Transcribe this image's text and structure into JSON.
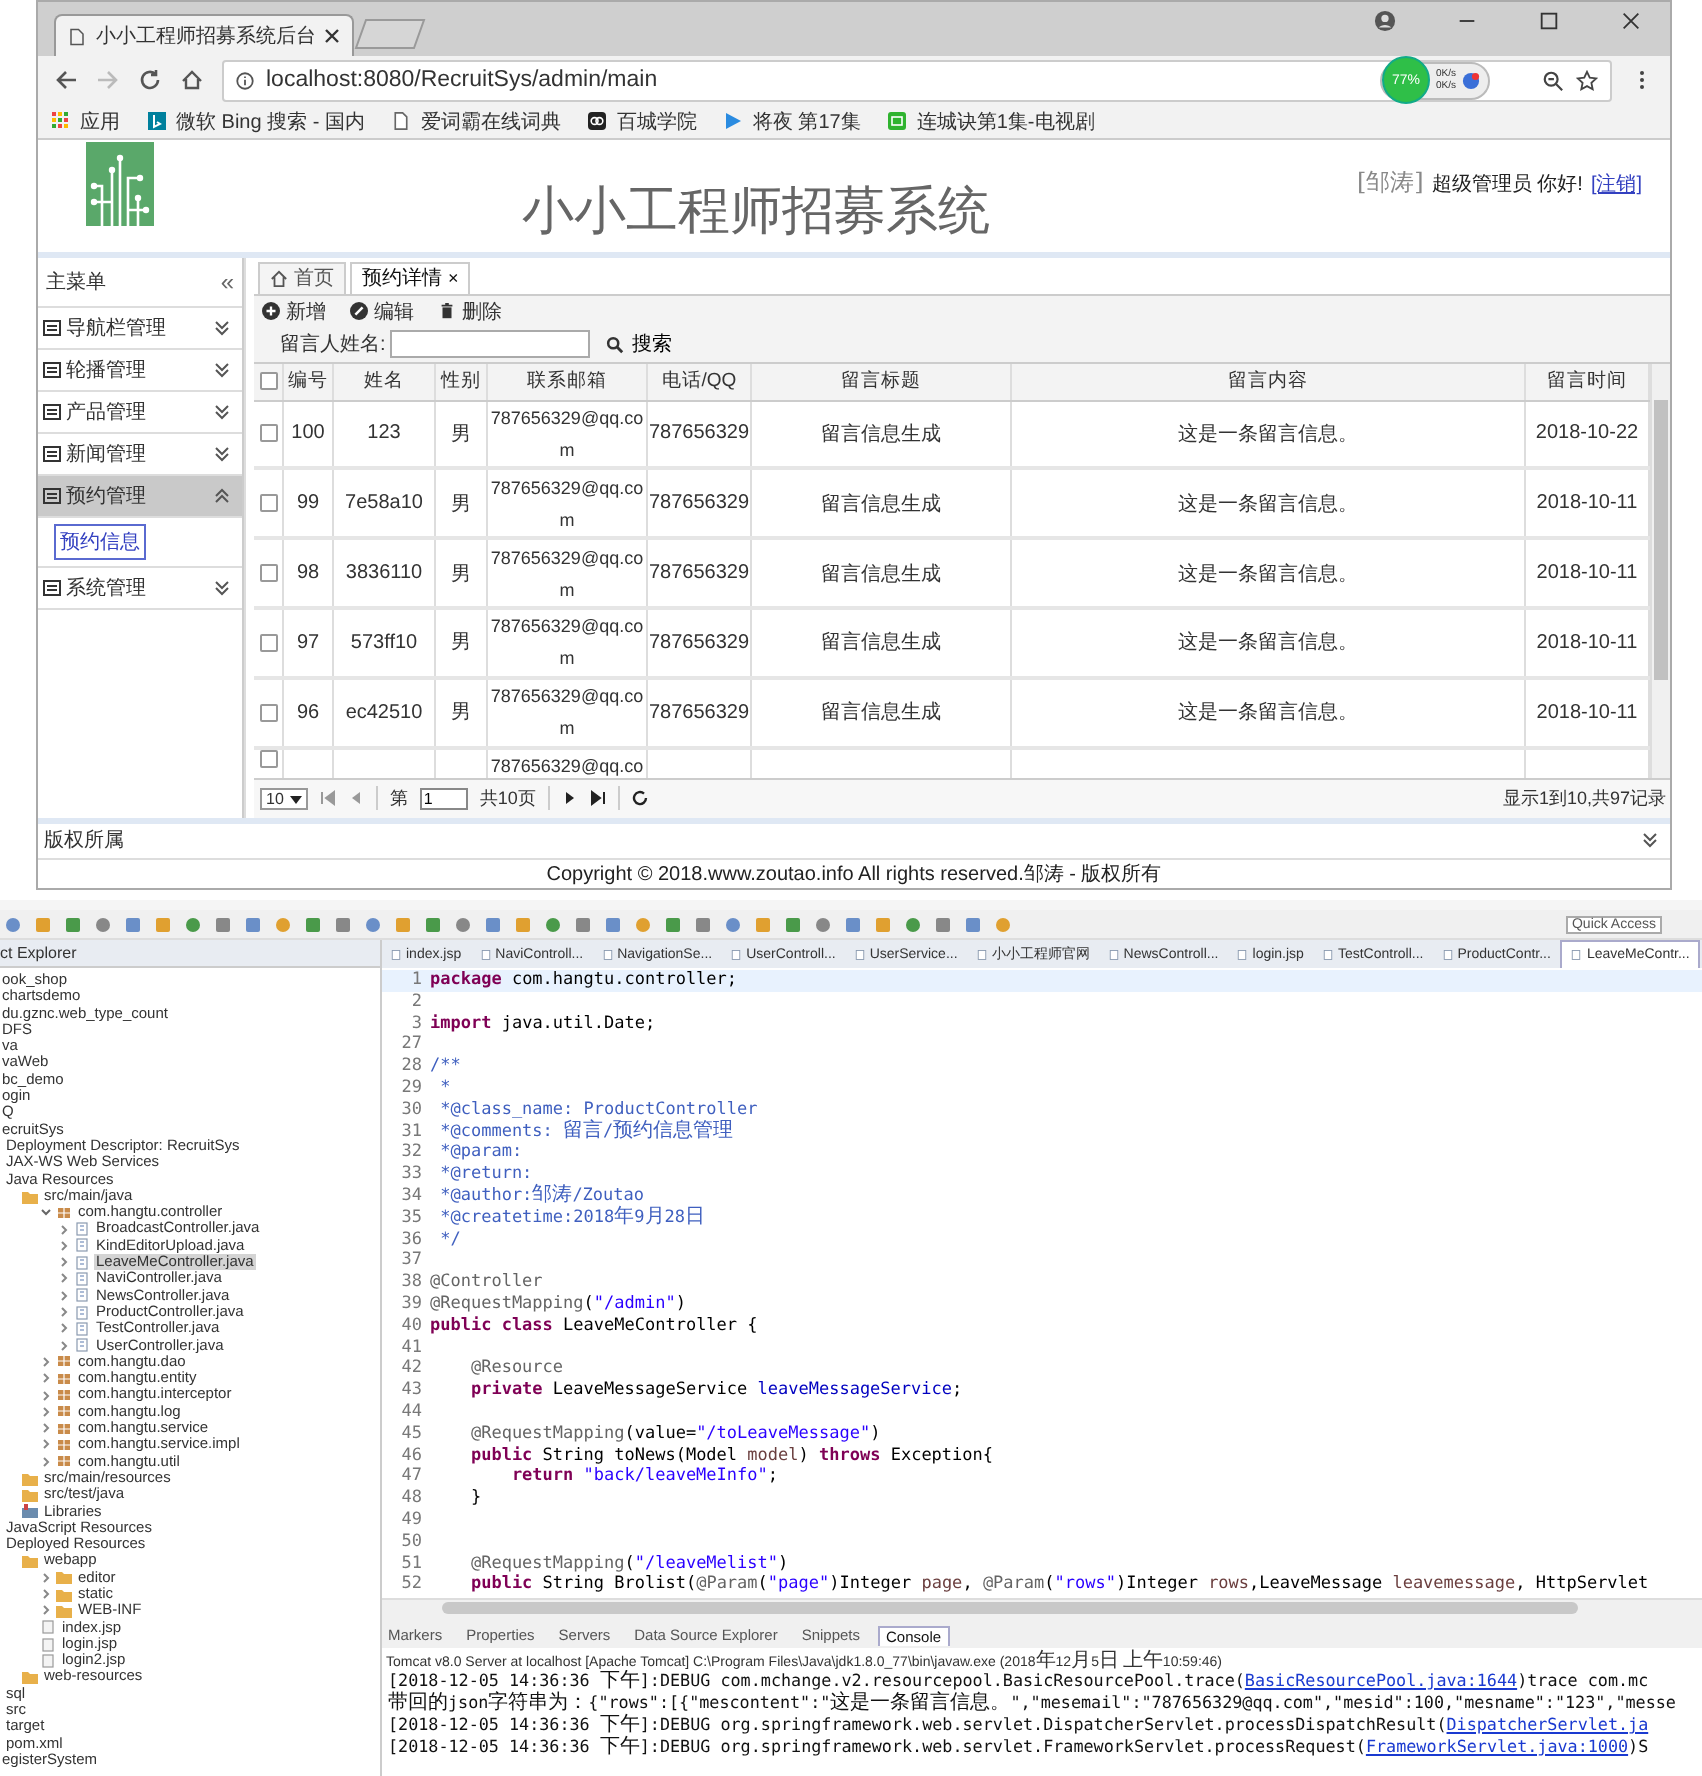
{
  "browser": {
    "tab": {
      "title": "小小工程师招募系统后台",
      "selected": true
    },
    "address": "localhost:8080/RecruitSys/admin/main",
    "extension": {
      "percent": "77%",
      "up": "0K/s",
      "down": "0K/s"
    },
    "bookmarks": [
      {
        "label": "应用",
        "kind": "apps"
      },
      {
        "label": "微软 Bing 搜索 - 国内",
        "kind": "bing"
      },
      {
        "label": "爱词霸在线词典",
        "kind": "page"
      },
      {
        "label": "百城学院",
        "kind": "dark"
      },
      {
        "label": "将夜 第17集",
        "kind": "play"
      },
      {
        "label": "连城诀第1集-电视剧",
        "kind": "green"
      }
    ]
  },
  "page": {
    "title": "小小工程师招募系统",
    "user": "[邹涛]",
    "greeting": "超级管理员 你好!",
    "logout": "[注销]",
    "menu_title": "主菜单",
    "collapse_mark": "«",
    "menu": [
      {
        "label": "导航栏管理",
        "expanded": false,
        "selected": false
      },
      {
        "label": "轮播管理",
        "expanded": false,
        "selected": false
      },
      {
        "label": "产品管理",
        "expanded": false,
        "selected": false
      },
      {
        "label": "新闻管理",
        "expanded": false,
        "selected": false
      },
      {
        "label": "预约管理",
        "expanded": true,
        "selected": true,
        "children": [
          {
            "label": "预约信息",
            "selected": true
          }
        ]
      },
      {
        "label": "系统管理",
        "expanded": false,
        "selected": false
      }
    ],
    "tabs": [
      {
        "label": "首页",
        "selected": false,
        "closable": false
      },
      {
        "label": "预约详情",
        "selected": true,
        "closable": true
      }
    ],
    "close_mark": "×",
    "toolbar": [
      "新增",
      "编辑",
      "删除"
    ],
    "search": {
      "label": "留言人姓名:",
      "button": "搜索"
    },
    "table": {
      "all_checked": false,
      "columns": [
        "编号",
        "姓名",
        "性别",
        "联系邮箱",
        "电话/QQ",
        "留言标题",
        "留言内容",
        "留言时间"
      ],
      "rows": [
        {
          "checked": false,
          "cells": [
            "100",
            "123",
            "男",
            "787656329@qq.com",
            "787656329",
            "留言信息生成",
            "这是一条留言信息。",
            "2018-10-22"
          ]
        },
        {
          "checked": false,
          "cells": [
            "99",
            "7e58a10",
            "男",
            "787656329@qq.com",
            "787656329",
            "留言信息生成",
            "这是一条留言信息。",
            "2018-10-11"
          ]
        },
        {
          "checked": false,
          "cells": [
            "98",
            "3836110",
            "男",
            "787656329@qq.com",
            "787656329",
            "留言信息生成",
            "这是一条留言信息。",
            "2018-10-11"
          ]
        },
        {
          "checked": false,
          "cells": [
            "97",
            "573ff10",
            "男",
            "787656329@qq.com",
            "787656329",
            "留言信息生成",
            "这是一条留言信息。",
            "2018-10-11"
          ]
        },
        {
          "checked": false,
          "cells": [
            "96",
            "ec42510",
            "男",
            "787656329@qq.com",
            "787656329",
            "留言信息生成",
            "这是一条留言信息。",
            "2018-10-11"
          ]
        },
        {
          "checked": false,
          "cells": [
            null,
            null,
            null,
            "787656329@qq.co",
            null,
            null,
            null,
            null
          ]
        }
      ]
    },
    "pager": {
      "size": "10",
      "page_label": "第",
      "page": "1",
      "total": "共10页",
      "summary": "显示1到10,共97记录"
    },
    "footer_title": "版权所属",
    "copyright": "Copyright © 2018.www.zoutao.info All rights reserved.邹涛 - 版权所有"
  },
  "ide": {
    "explorer_title": "ct Explorer",
    "tree": [
      {
        "label": "ook_shop",
        "selected": false
      },
      {
        "label": "chartsdemo",
        "selected": false
      },
      {
        "label": "du.gznc.web_type_count",
        "selected": false
      },
      {
        "label": "DFS",
        "selected": false
      },
      {
        "label": "va",
        "selected": false
      },
      {
        "label": "vaWeb",
        "selected": false
      },
      {
        "label": "bc_demo",
        "selected": false
      },
      {
        "label": "ogin",
        "selected": false
      },
      {
        "label": "Q",
        "selected": false
      },
      {
        "label": "ecruitSys",
        "selected": false,
        "children": [
          {
            "label": "Deployment Descriptor: RecruitSys",
            "selected": false
          },
          {
            "label": "JAX-WS Web Services",
            "selected": false
          },
          {
            "label": "Java Resources",
            "selected": false,
            "children": [
              {
                "label": "src/main/java",
                "kind": "folder",
                "selected": false,
                "children": [
                  {
                    "label": "com.hangtu.controller",
                    "kind": "package",
                    "expanded": true,
                    "selected": false,
                    "children": [
                      {
                        "label": "BroadcastController.java",
                        "kind": "java",
                        "expanded": false,
                        "selected": false
                      },
                      {
                        "label": "KindEditorUpload.java",
                        "kind": "java",
                        "expanded": false,
                        "selected": false
                      },
                      {
                        "label": "LeaveMeController.java",
                        "kind": "java",
                        "expanded": false,
                        "selected": true
                      },
                      {
                        "label": "NaviController.java",
                        "kind": "java",
                        "expanded": false,
                        "selected": false
                      },
                      {
                        "label": "NewsController.java",
                        "kind": "java",
                        "expanded": false,
                        "selected": false
                      },
                      {
                        "label": "ProductController.java",
                        "kind": "java",
                        "expanded": false,
                        "selected": false
                      },
                      {
                        "label": "TestController.java",
                        "kind": "java",
                        "expanded": false,
                        "selected": false
                      },
                      {
                        "label": "UserController.java",
                        "kind": "java",
                        "expanded": false,
                        "selected": false
                      }
                    ]
                  },
                  {
                    "label": "com.hangtu.dao",
                    "kind": "package",
                    "expanded": false,
                    "selected": false
                  },
                  {
                    "label": "com.hangtu.entity",
                    "kind": "package",
                    "expanded": false,
                    "selected": false
                  },
                  {
                    "label": "com.hangtu.interceptor",
                    "kind": "package",
                    "expanded": false,
                    "selected": false
                  },
                  {
                    "label": "com.hangtu.log",
                    "kind": "package",
                    "expanded": false,
                    "selected": false
                  },
                  {
                    "label": "com.hangtu.service",
                    "kind": "package",
                    "expanded": false,
                    "selected": false
                  },
                  {
                    "label": "com.hangtu.service.impl",
                    "kind": "package",
                    "expanded": false,
                    "selected": false
                  },
                  {
                    "label": "com.hangtu.util",
                    "kind": "package",
                    "expanded": false,
                    "selected": false
                  }
                ]
              },
              {
                "label": "src/main/resources",
                "kind": "folder",
                "selected": false
              },
              {
                "label": "src/test/java",
                "kind": "folder",
                "selected": false
              },
              {
                "label": "Libraries",
                "kind": "library",
                "selected": false
              }
            ]
          },
          {
            "label": "JavaScript Resources",
            "selected": false
          },
          {
            "label": "Deployed Resources",
            "selected": false,
            "children": [
              {
                "label": "webapp",
                "kind": "folder",
                "selected": false,
                "children": [
                  {
                    "label": "editor",
                    "kind": "folder",
                    "expanded": false,
                    "selected": false
                  },
                  {
                    "label": "static",
                    "kind": "folder",
                    "expanded": false,
                    "selected": false
                  },
                  {
                    "label": "WEB-INF",
                    "kind": "folder",
                    "expanded": false,
                    "selected": false
                  },
                  {
                    "label": "index.jsp",
                    "kind": "file",
                    "selected": false
                  },
                  {
                    "label": "login.jsp",
                    "kind": "file",
                    "selected": false
                  },
                  {
                    "label": "login2.jsp",
                    "kind": "file",
                    "selected": false
                  }
                ]
              },
              {
                "label": "web-resources",
                "kind": "folder",
                "selected": false
              }
            ]
          },
          {
            "label": "sql",
            "selected": false
          },
          {
            "label": "src",
            "selected": false
          },
          {
            "label": "target",
            "selected": false
          },
          {
            "label": "pom.xml",
            "selected": false
          }
        ]
      },
      {
        "label": "egisterSystem",
        "selected": false
      }
    ],
    "quick_access": "Quick Access",
    "editor_tabs": [
      {
        "label": "index.jsp",
        "selected": false
      },
      {
        "label": "NaviControll...",
        "selected": false
      },
      {
        "label": "NavigationSe...",
        "selected": false
      },
      {
        "label": "UserControll...",
        "selected": false
      },
      {
        "label": "UserService...",
        "selected": false
      },
      {
        "label": "小小工程师官网",
        "selected": false
      },
      {
        "label": "NewsControll...",
        "selected": false
      },
      {
        "label": "login.jsp",
        "selected": false
      },
      {
        "label": "TestControll...",
        "selected": false
      },
      {
        "label": "ProductContr...",
        "selected": false
      },
      {
        "label": "LeaveMeContr...",
        "selected": true
      }
    ],
    "code": [
      {
        "n": "1",
        "segments": [
          {
            "kind": "keyword",
            "text": "package"
          },
          {
            "kind": "plain",
            "text": " com.hangtu.controller;"
          }
        ]
      },
      {
        "n": "2"
      },
      {
        "n": "3",
        "segments": [
          {
            "kind": "keyword",
            "text": "import"
          },
          {
            "kind": "plain",
            "text": " java.util.Date;"
          }
        ]
      },
      {
        "n": "27"
      },
      {
        "n": "28",
        "segments": [
          {
            "kind": "doc",
            "text": "/**"
          }
        ]
      },
      {
        "n": "29",
        "segments": [
          {
            "kind": "doc",
            "text": " *"
          }
        ]
      },
      {
        "n": "30",
        "segments": [
          {
            "kind": "doc",
            "text": " *@class_name: ProductController"
          }
        ]
      },
      {
        "n": "31",
        "segments": [
          {
            "kind": "doc",
            "text": " *@comments: 留言/预约信息管理"
          }
        ]
      },
      {
        "n": "32",
        "segments": [
          {
            "kind": "doc",
            "text": " *@param:"
          }
        ]
      },
      {
        "n": "33",
        "segments": [
          {
            "kind": "doc",
            "text": " *@return:"
          }
        ]
      },
      {
        "n": "34",
        "segments": [
          {
            "kind": "doc",
            "text": " *@author:邹涛/Zoutao"
          }
        ]
      },
      {
        "n": "35",
        "segments": [
          {
            "kind": "doc",
            "text": " *@createtime:2018年9月28日"
          }
        ]
      },
      {
        "n": "36",
        "segments": [
          {
            "kind": "doc",
            "text": " */"
          }
        ]
      },
      {
        "n": "37"
      },
      {
        "n": "38",
        "segments": [
          {
            "kind": "annotation",
            "text": "@Controller"
          }
        ]
      },
      {
        "n": "39",
        "segments": [
          {
            "kind": "annotation",
            "text": "@RequestMapping"
          },
          {
            "kind": "plain",
            "text": "("
          },
          {
            "kind": "string",
            "text": "\"/admin\""
          },
          {
            "kind": "plain",
            "text": ")"
          }
        ]
      },
      {
        "n": "40",
        "segments": [
          {
            "kind": "keyword",
            "text": "public class"
          },
          {
            "kind": "plain",
            "text": " LeaveMeController {"
          }
        ]
      },
      {
        "n": "41"
      },
      {
        "n": "42",
        "segments": [
          {
            "kind": "annotation",
            "text": "    @Resource"
          }
        ]
      },
      {
        "n": "43",
        "segments": [
          {
            "kind": "keyword",
            "text": "    private"
          },
          {
            "kind": "plain",
            "text": " LeaveMessageService "
          },
          {
            "kind": "field",
            "text": "leaveMessageService"
          },
          {
            "kind": "plain",
            "text": ";"
          }
        ]
      },
      {
        "n": "44"
      },
      {
        "n": "45",
        "segments": [
          {
            "kind": "annotation",
            "text": "    @RequestMapping"
          },
          {
            "kind": "plain",
            "text": "(value="
          },
          {
            "kind": "string",
            "text": "\"/toLeaveMessage\""
          },
          {
            "kind": "plain",
            "text": ")"
          }
        ]
      },
      {
        "n": "46",
        "segments": [
          {
            "kind": "keyword",
            "text": "    public"
          },
          {
            "kind": "plain",
            "text": " String toNews(Model "
          },
          {
            "kind": "variable",
            "text": "model"
          },
          {
            "kind": "plain",
            "text": ") "
          },
          {
            "kind": "keyword",
            "text": "throws"
          },
          {
            "kind": "plain",
            "text": " Exception{"
          }
        ]
      },
      {
        "n": "47",
        "segments": [
          {
            "kind": "keyword",
            "text": "        return "
          },
          {
            "kind": "string",
            "text": "\"back/leaveMeInfo\""
          },
          {
            "kind": "plain",
            "text": ";"
          }
        ]
      },
      {
        "n": "48",
        "segments": [
          {
            "kind": "plain",
            "text": "    }"
          }
        ]
      },
      {
        "n": "49"
      },
      {
        "n": "50"
      },
      {
        "n": "51",
        "segments": [
          {
            "kind": "annotation",
            "text": "    @RequestMapping"
          },
          {
            "kind": "plain",
            "text": "("
          },
          {
            "kind": "string",
            "text": "\"/leaveMelist\""
          },
          {
            "kind": "plain",
            "text": ")"
          }
        ]
      },
      {
        "n": "52",
        "segments": [
          {
            "kind": "keyword",
            "text": "    public"
          },
          {
            "kind": "plain",
            "text": " String Brolist("
          },
          {
            "kind": "annotation",
            "text": "@Param"
          },
          {
            "kind": "plain",
            "text": "("
          },
          {
            "kind": "string",
            "text": "\"page\""
          },
          {
            "kind": "plain",
            "text": ")Integer "
          },
          {
            "kind": "variable",
            "text": "page"
          },
          {
            "kind": "plain",
            "text": ", "
          },
          {
            "kind": "annotation",
            "text": "@Param"
          },
          {
            "kind": "plain",
            "text": "("
          },
          {
            "kind": "string",
            "text": "\"rows\""
          },
          {
            "kind": "plain",
            "text": ")Integer "
          },
          {
            "kind": "variable",
            "text": "rows"
          },
          {
            "kind": "plain",
            "text": ",LeaveMessage "
          },
          {
            "kind": "variable",
            "text": "leavemessage"
          },
          {
            "kind": "plain",
            "text": ", HttpServlet"
          }
        ]
      }
    ],
    "bottom_tabs": [
      {
        "label": "Markers",
        "selected": false
      },
      {
        "label": "Properties",
        "selected": false
      },
      {
        "label": "Servers",
        "selected": false
      },
      {
        "label": "Data Source Explorer",
        "selected": false
      },
      {
        "label": "Snippets",
        "selected": false
      },
      {
        "label": "Console",
        "selected": true
      }
    ],
    "console_title": "Tomcat v8.0 Server at localhost [Apache Tomcat] C:\\Program Files\\Java\\jdk1.8.0_77\\bin\\javaw.exe (2018年12月5日 上午10:59:46)",
    "console": [
      {
        "text": "[2018-12-05 14:36:36 下午]:DEBUG com.mchange.v2.resourcepool.BasicResourcePool.trace(",
        "link": "BasicResourcePool.java:1644",
        "after": ")trace com.mc"
      },
      {
        "text": "带回的json字符串为：{\"rows\":[{\"mescontent\":\"这是一条留言信息。\",\"mesemail\":\"787656329@qq.com\",\"mesid\":100,\"mesname\":\"123\",\"messe"
      },
      {
        "text": "[2018-12-05 14:36:36 下午]:DEBUG org.springframework.web.servlet.DispatcherServlet.processDispatchResult(",
        "link": "DispatcherServlet.ja"
      },
      {
        "text": "[2018-12-05 14:36:36 下午]:DEBUG org.springframework.web.servlet.FrameworkServlet.processRequest(",
        "link": "FrameworkServlet.java:1000",
        "after": ")S"
      }
    ]
  }
}
